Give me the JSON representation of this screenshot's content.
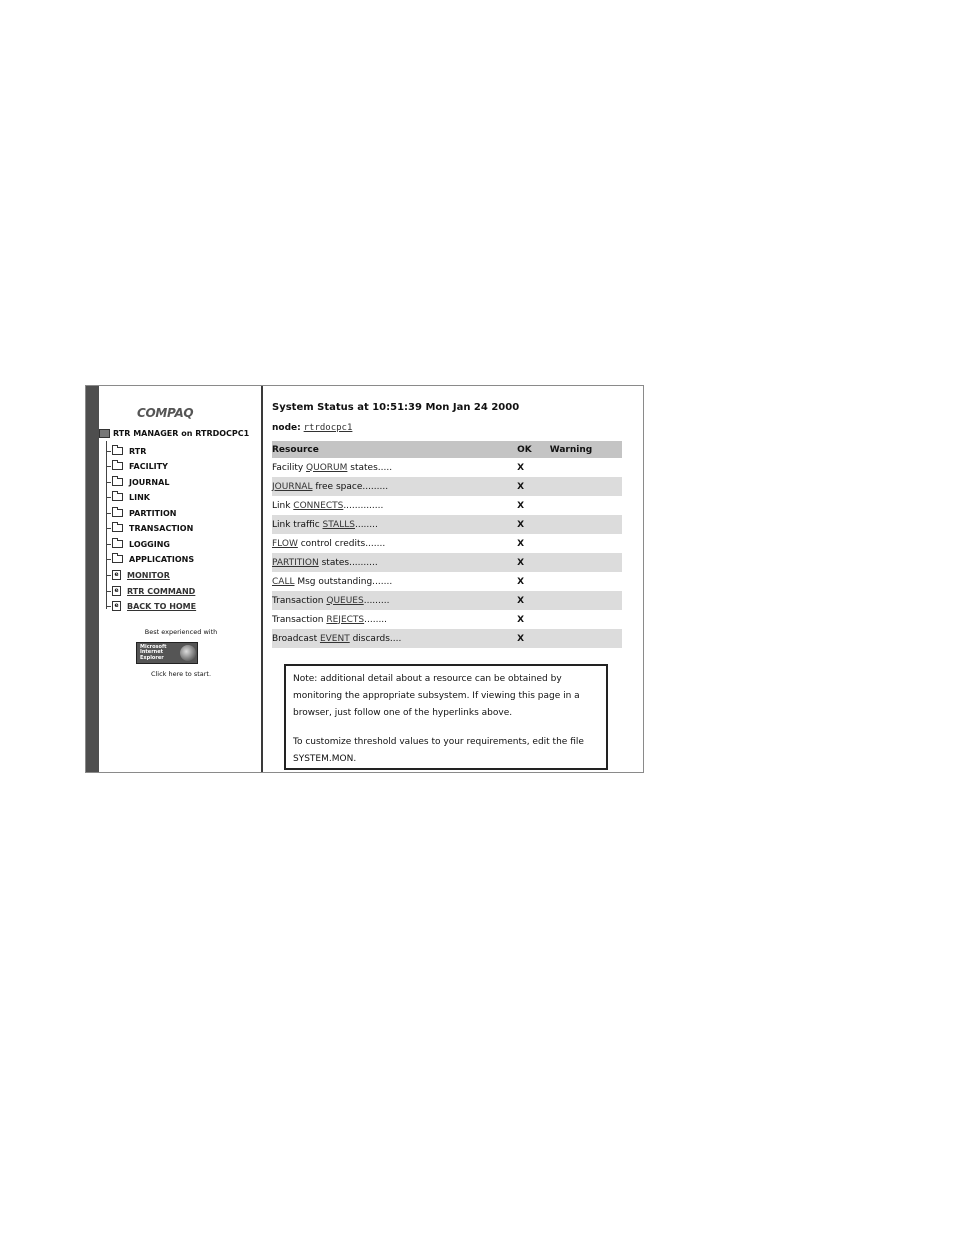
{
  "sidebar": {
    "logo": "COMPAQ",
    "root_label": "RTR MANAGER on RTRDOCPC1",
    "items": [
      {
        "label": "RTR",
        "type": "folder",
        "link": false
      },
      {
        "label": "FACILITY",
        "type": "folder",
        "link": false
      },
      {
        "label": "JOURNAL",
        "type": "folder",
        "link": false
      },
      {
        "label": "LINK",
        "type": "folder",
        "link": false
      },
      {
        "label": "PARTITION",
        "type": "folder",
        "link": false
      },
      {
        "label": "TRANSACTION",
        "type": "folder",
        "link": false
      },
      {
        "label": "LOGGING",
        "type": "folder",
        "link": false
      },
      {
        "label": "APPLICATIONS",
        "type": "folder",
        "link": false
      },
      {
        "label": "MONITOR",
        "type": "page",
        "link": true
      },
      {
        "label": "RTR COMMAND",
        "type": "page",
        "link": true
      },
      {
        "label": "BACK TO HOME",
        "type": "page",
        "link": true
      }
    ],
    "best_experienced": "Best experienced with",
    "ie_badge_lines": [
      "Microsoft",
      "Internet",
      "Explorer"
    ],
    "click_here": "Click here to start."
  },
  "main": {
    "title": "System Status at 10:51:39 Mon Jan 24 2000",
    "node_label": "node:",
    "node_value": "rtrdocpc1",
    "table": {
      "headers": {
        "resource": "Resource",
        "ok": "OK",
        "warning": "Warning"
      },
      "rows": [
        {
          "prefix": "Facility ",
          "link": "QUORUM",
          "suffix": " states.....",
          "ok": "X",
          "warning": ""
        },
        {
          "prefix": "",
          "link": "JOURNAL",
          "suffix": " free space.........",
          "ok": "X",
          "warning": ""
        },
        {
          "prefix": "Link ",
          "link": "CONNECTS",
          "suffix": "..............",
          "ok": "X",
          "warning": ""
        },
        {
          "prefix": "Link traffic ",
          "link": "STALLS",
          "suffix": "........",
          "ok": "X",
          "warning": ""
        },
        {
          "prefix": "",
          "link": "FLOW",
          "suffix": " control credits.......",
          "ok": "X",
          "warning": ""
        },
        {
          "prefix": "",
          "link": "PARTITION",
          "suffix": " states..........",
          "ok": "X",
          "warning": ""
        },
        {
          "prefix": "",
          "link": "CALL",
          "suffix": " Msg outstanding.......",
          "ok": "X",
          "warning": ""
        },
        {
          "prefix": "Transaction ",
          "link": "QUEUES",
          "suffix": ".........",
          "ok": "X",
          "warning": ""
        },
        {
          "prefix": "Transaction ",
          "link": "REJECTS",
          "suffix": "........",
          "ok": "X",
          "warning": ""
        },
        {
          "prefix": "Broadcast ",
          "link": "EVENT",
          "suffix": " discards....",
          "ok": "X",
          "warning": ""
        }
      ]
    },
    "note": {
      "para1": "Note: additional detail about a resource can be obtained by monitoring the appropriate subsystem. If viewing this page in a browser, just follow one of the hyperlinks above.",
      "para2": "To customize threshold values to your requirements, edit the file SYSTEM.MON."
    }
  }
}
